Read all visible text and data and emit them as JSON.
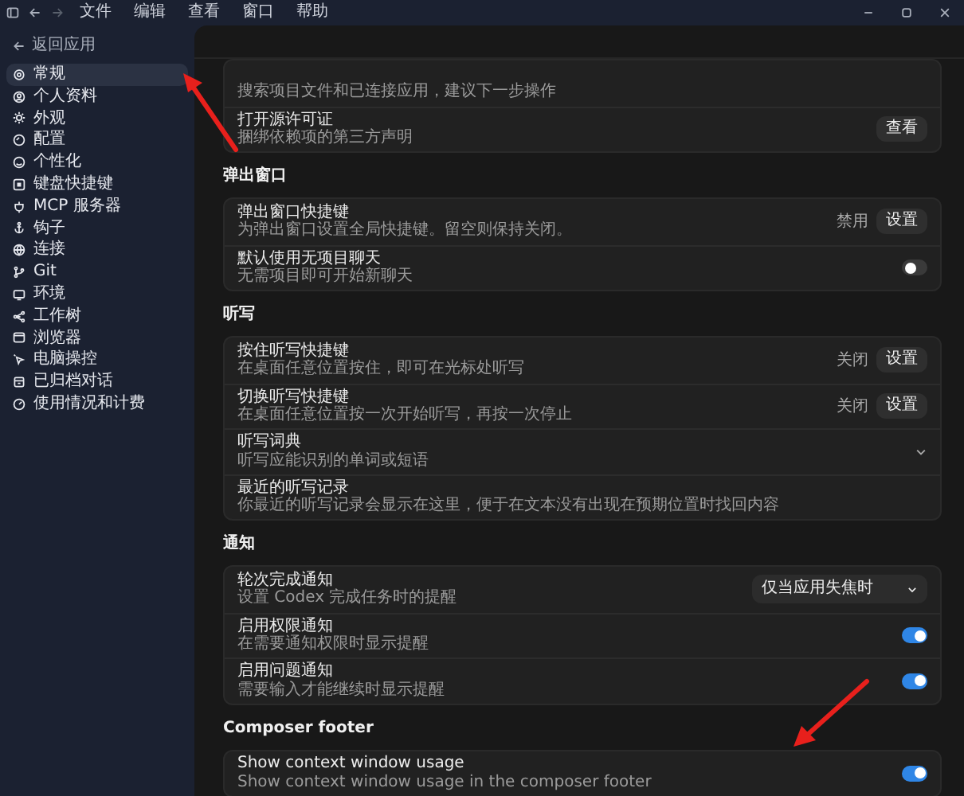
{
  "titlebar": {
    "menu": [
      "文件",
      "编辑",
      "查看",
      "窗口",
      "帮助"
    ]
  },
  "sidebar": {
    "back": "返回应用",
    "items": [
      {
        "label": "常规",
        "selected": true
      },
      {
        "label": "个人资料",
        "selected": false
      },
      {
        "label": "外观",
        "selected": false
      },
      {
        "label": "配置",
        "selected": false
      },
      {
        "label": "个性化",
        "selected": false
      },
      {
        "label": "键盘快捷键",
        "selected": false
      },
      {
        "label": "MCP 服务器",
        "selected": false
      },
      {
        "label": "钩子",
        "selected": false
      },
      {
        "label": "连接",
        "selected": false
      },
      {
        "label": "Git",
        "selected": false
      },
      {
        "label": "环境",
        "selected": false
      },
      {
        "label": "工作树",
        "selected": false
      },
      {
        "label": "浏览器",
        "selected": false
      },
      {
        "label": "电脑操控",
        "selected": false
      },
      {
        "label": "已归档对话",
        "selected": false
      },
      {
        "label": "使用情况和计费",
        "selected": false
      }
    ]
  },
  "sections": [
    {
      "rows": [
        {
          "kind": "text",
          "description": "搜索项目文件和已连接应用，建议下一步操作"
        },
        {
          "kind": "button",
          "title": "打开源许可证",
          "description": "捆绑依赖项的第三方声明",
          "button": "查看"
        }
      ]
    },
    {
      "heading": "弹出窗口",
      "rows": [
        {
          "kind": "button",
          "title": "弹出窗口快捷键",
          "description": "为弹出窗口设置全局快捷键。留空则保持关闭。",
          "status": "禁用",
          "button": "设置"
        },
        {
          "kind": "toggle",
          "title": "默认使用无项目聊天",
          "description": "无需项目即可开始新聊天",
          "on": false
        }
      ]
    },
    {
      "heading": "听写",
      "rows": [
        {
          "kind": "button",
          "title": "按住听写快捷键",
          "description": "在桌面任意位置按住，即可在光标处听写",
          "status": "关闭",
          "button": "设置"
        },
        {
          "kind": "button",
          "title": "切换听写快捷键",
          "description": "在桌面任意位置按一次开始听写，再按一次停止",
          "status": "关闭",
          "button": "设置"
        },
        {
          "kind": "expand",
          "title": "听写词典",
          "description": "听写应能识别的单词或短语",
          "expanded": false
        },
        {
          "kind": "text",
          "title": "最近的听写记录",
          "description": "你最近的听写记录会显示在这里，便于在文本没有出现在预期位置时找回内容"
        }
      ]
    },
    {
      "heading": "通知",
      "rows": [
        {
          "kind": "select",
          "title": "轮次完成通知",
          "description": "设置 Codex 完成任务时的提醒",
          "value": "仅当应用失焦时"
        },
        {
          "kind": "toggle",
          "title": "启用权限通知",
          "description": "在需要通知权限时显示提醒",
          "on": true
        },
        {
          "kind": "toggle",
          "title": "启用问题通知",
          "description": "需要输入才能继续时显示提醒",
          "on": true
        }
      ]
    },
    {
      "heading": "Composer footer",
      "rows": [
        {
          "kind": "toggle",
          "title": "Show context window usage",
          "description": "Show context window usage in the composer footer",
          "on": true
        }
      ]
    }
  ]
}
